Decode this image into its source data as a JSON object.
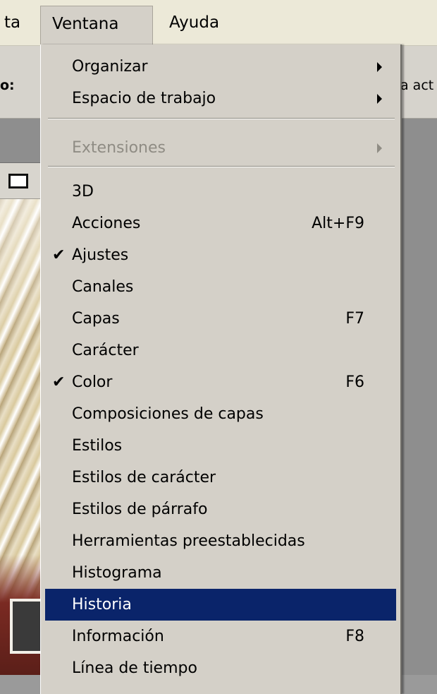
{
  "menubar": {
    "partial_left": "ta",
    "ventana": "Ventana",
    "ayuda": "Ayuda"
  },
  "optionsbar": {
    "label_left": "o:",
    "label_right": "a act"
  },
  "menu": {
    "submenus": [
      {
        "label": "Organizar",
        "has_submenu": true
      },
      {
        "label": "Espacio de trabajo",
        "has_submenu": true
      },
      {
        "label": "Extensiones",
        "has_submenu": true,
        "disabled": true
      }
    ],
    "items": [
      {
        "label": "3D",
        "shortcut": "",
        "checked": false
      },
      {
        "label": "Acciones",
        "shortcut": "Alt+F9",
        "checked": false
      },
      {
        "label": "Ajustes",
        "shortcut": "",
        "checked": true
      },
      {
        "label": "Canales",
        "shortcut": "",
        "checked": false
      },
      {
        "label": "Capas",
        "shortcut": "F7",
        "checked": false
      },
      {
        "label": "Carácter",
        "shortcut": "",
        "checked": false
      },
      {
        "label": "Color",
        "shortcut": "F6",
        "checked": true
      },
      {
        "label": "Composiciones de capas",
        "shortcut": "",
        "checked": false
      },
      {
        "label": "Estilos",
        "shortcut": "",
        "checked": false
      },
      {
        "label": "Estilos de carácter",
        "shortcut": "",
        "checked": false
      },
      {
        "label": "Estilos de párrafo",
        "shortcut": "",
        "checked": false
      },
      {
        "label": "Herramientas preestablecidas",
        "shortcut": "",
        "checked": false
      },
      {
        "label": "Histograma",
        "shortcut": "",
        "checked": false
      },
      {
        "label": "Historia",
        "shortcut": "",
        "checked": false,
        "highlighted": true
      },
      {
        "label": "Información",
        "shortcut": "F8",
        "checked": false
      },
      {
        "label": "Línea de tiempo",
        "shortcut": "",
        "checked": false
      }
    ],
    "check_glyph": "✔"
  },
  "colors": {
    "highlight": "#0a246a",
    "menu_bg": "#d4d0c8",
    "disabled_text": "#8f8c84"
  }
}
